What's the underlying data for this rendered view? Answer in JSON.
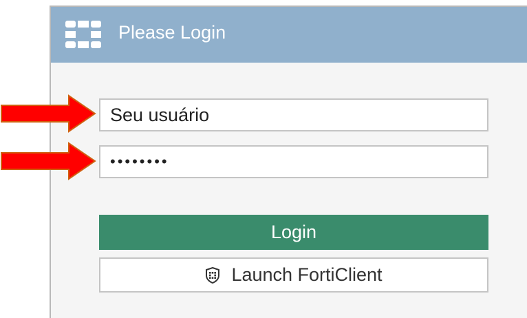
{
  "window": {
    "title": "Please Login"
  },
  "form": {
    "username_value": "Seu usuário",
    "password_value": "••••••••",
    "login_label": "Login",
    "forticlient_label": "Launch FortiClient"
  },
  "colors": {
    "header": "#90b0cc",
    "login_button": "#3a8c6c",
    "annotation_arrow": "#ff0000"
  },
  "icons": {
    "header": "fortinet-logo-icon",
    "forticlient": "forticlient-shield-icon",
    "annotations": "red-arrow-icon"
  }
}
